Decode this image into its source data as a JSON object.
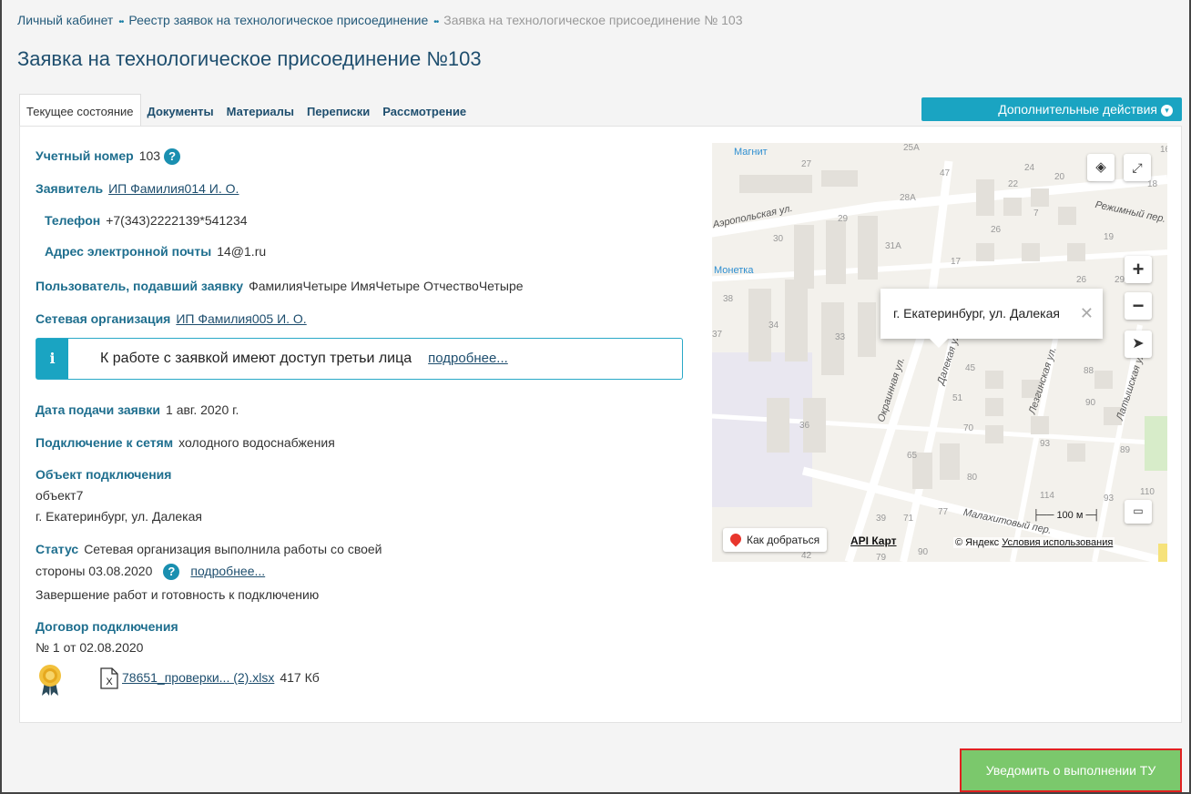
{
  "breadcrumb": {
    "items": [
      "Личный кабинет",
      "Реестр заявок на технологическое присоединение"
    ],
    "current": "Заявка на технологическое присоединение № 103",
    "separator": "••"
  },
  "page": {
    "title": "Заявка на технологическое присоединение №103"
  },
  "tabs": [
    {
      "label": "Текущее состояние",
      "active": true
    },
    {
      "label": "Документы"
    },
    {
      "label": "Материалы"
    },
    {
      "label": "Переписки"
    },
    {
      "label": "Рассмотрение"
    }
  ],
  "actions": {
    "extra_label": "Дополнительные действия",
    "notify_label": "Уведомить о выполнении ТУ"
  },
  "details": {
    "account_label": "Учетный номер",
    "account_value": "103",
    "applicant_label": "Заявитель",
    "applicant_value": "ИП Фамилия014 И. О.",
    "phone_label": "Телефон",
    "phone_value": "+7(343)2222139*541234",
    "email_label": "Адрес электронной почты",
    "email_value": "14@1.ru",
    "user_label": "Пользователь, подавший заявку",
    "user_value": "ФамилияЧетыре ИмяЧетыре ОтчествоЧетыре",
    "org_label": "Сетевая организация",
    "org_value": "ИП Фамилия005 И. О.",
    "notice_text": "К работе с заявкой имеют доступ третьи лица",
    "notice_more": "подробнее...",
    "date_label": "Дата подачи заявки",
    "date_value": "1 авг. 2020 г.",
    "networks_label": "Подключение к сетям",
    "networks_value": "холодного водоснабжения",
    "object_label": "Объект подключения",
    "object_name": "объект7",
    "object_address": "г. Екатеринбург, ул. Далекая",
    "status_label": "Статус",
    "status_line1": "Сетевая организация выполнила работы со своей",
    "status_line2": "стороны 03.08.2020",
    "status_more": "подробнее...",
    "status_note": "Завершение работ и готовность к подключению",
    "contract_label": "Договор подключения",
    "contract_value": "№ 1 от 02.08.2020",
    "file_name": "78651_проверки... (2).xlsx",
    "file_size": "417 Кб"
  },
  "map": {
    "balloon": "г. Екатеринбург, ул. Далекая",
    "route": "Как добраться",
    "api": "API Карт",
    "copyright": "© Яндекс",
    "terms": "Условия использования",
    "scale": "100 м",
    "pois": [
      "Магнит",
      "Монетка"
    ],
    "streets": [
      "Аэропольская ул.",
      "Режимный пер.",
      "Окраинная ул.",
      "Далекая ул.",
      "Лезгинская ул.",
      "Латышская ул.",
      "Малахитовый пер."
    ],
    "numbers": [
      "25А",
      "27",
      "47",
      "24",
      "20",
      "22",
      "18",
      "28А",
      "29",
      "30",
      "31А",
      "26",
      "19",
      "17",
      "7",
      "26",
      "29",
      "38",
      "34",
      "33",
      "37",
      "45",
      "88",
      "51",
      "90",
      "36",
      "70",
      "93",
      "89",
      "65",
      "80",
      "114",
      "110",
      "93",
      "39",
      "71",
      "77",
      "42",
      "79",
      "90",
      "16"
    ]
  }
}
